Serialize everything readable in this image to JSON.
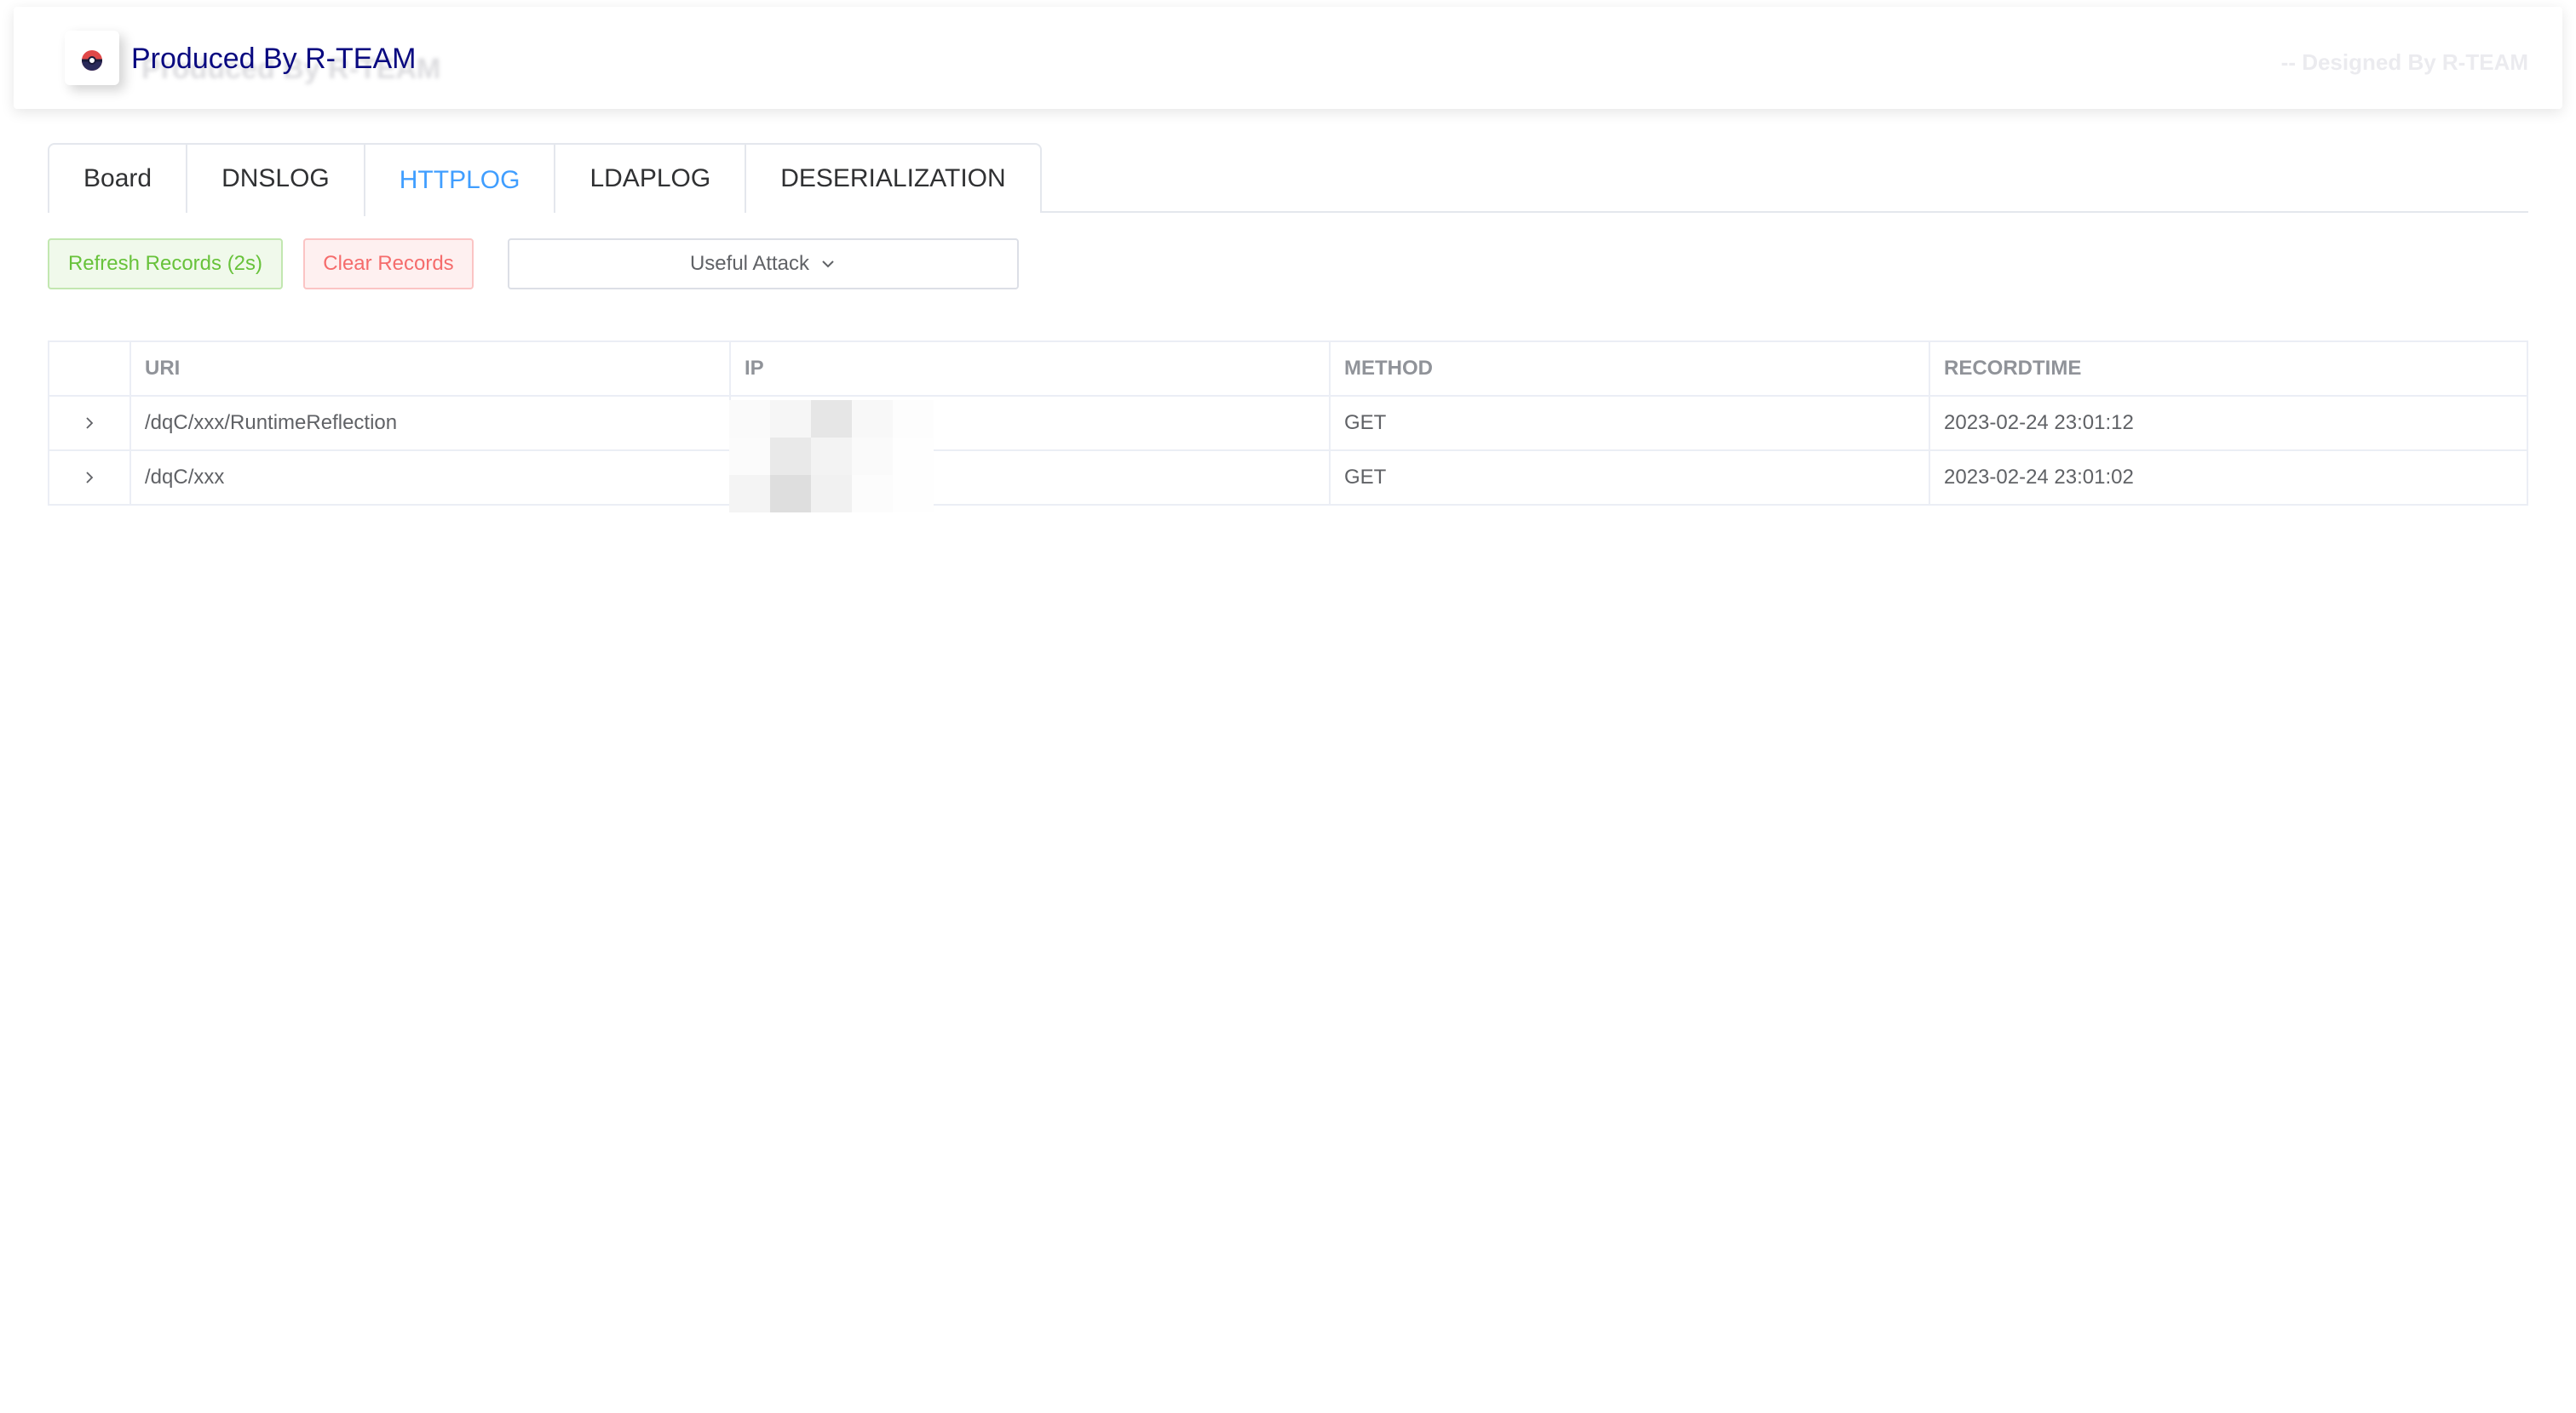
{
  "header": {
    "title": "Produced By R-TEAM",
    "subtitle": "-- Designed By R-TEAM",
    "logo_icon": "pokeball-icon"
  },
  "tabs": [
    {
      "label": "Board",
      "active": false
    },
    {
      "label": "DNSLOG",
      "active": false
    },
    {
      "label": "HTTPLOG",
      "active": true
    },
    {
      "label": "LDAPLOG",
      "active": false
    },
    {
      "label": "DESERIALIZATION",
      "active": false
    }
  ],
  "toolbar": {
    "refresh_label": "Refresh Records (2s)",
    "clear_label": "Clear Records",
    "attack_dropdown_label": "Useful Attack"
  },
  "table": {
    "columns": [
      "",
      "URI",
      "IP",
      "METHOD",
      "RECORDTIME"
    ],
    "rows": [
      {
        "uri": "/dqC/xxx/RuntimeReflection",
        "ip": "",
        "method": "GET",
        "recordtime": "2023-02-24 23:01:12"
      },
      {
        "uri": "/dqC/xxx",
        "ip": "",
        "method": "GET",
        "recordtime": "2023-02-24 23:01:02"
      }
    ]
  },
  "colors": {
    "accent": "#409eff",
    "title": "#0a0a80",
    "success": "#67c23a",
    "danger": "#f56c6c"
  }
}
